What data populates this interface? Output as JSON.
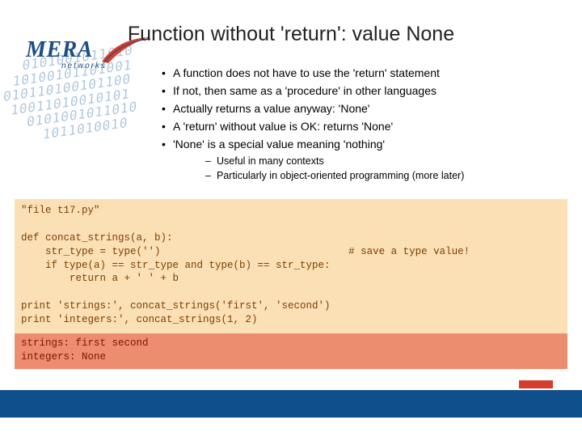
{
  "logo": {
    "main": "MERA",
    "sub": "networks"
  },
  "title": "Function without 'return': value None",
  "bullets": {
    "main": [
      "A function does not have to use the 'return' statement",
      "If not, then same as a 'procedure' in other languages",
      "Actually returns a value anyway: 'None'",
      "A 'return' without value is OK: returns 'None'",
      "'None' is a special value meaning 'nothing'"
    ],
    "sub": [
      "Useful in many contexts",
      "Particularly in object-oriented programming (more later)"
    ]
  },
  "code_block": "\"file t17.py\"\n\ndef concat_strings(a, b):\n    str_type = type('')                               # save a type value!\n    if type(a) == str_type and type(b) == str_type:\n        return a + ' ' + b\n\nprint 'strings:', concat_strings('first', 'second')\nprint 'integers:', concat_strings(1, 2)",
  "output_block": "strings: first second\nintegers: None",
  "bg_pattern": "  0101001011010\n 10100101101001\n010110100101100\n 10011010010101\n   0101001011010\n     1011010010",
  "colors": {
    "brand_blue": "#0f4f8c",
    "accent_red": "#d43e2a"
  }
}
